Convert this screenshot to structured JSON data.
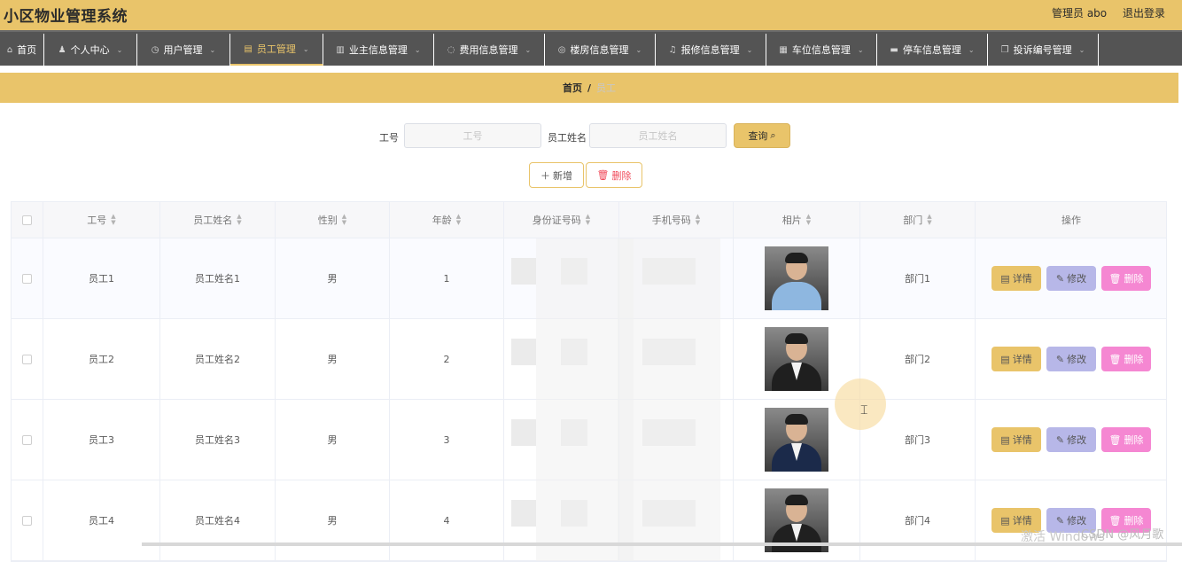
{
  "app": {
    "title": "小区物业管理系统"
  },
  "header": {
    "user_label": "管理员 abo",
    "logout_label": "退出登录"
  },
  "nav": {
    "items": [
      {
        "label": "首页",
        "icon": "home-icon",
        "glyph": "⌂",
        "has_caret": false
      },
      {
        "label": "个人中心",
        "icon": "user-icon",
        "glyph": "♟",
        "has_caret": true
      },
      {
        "label": "用户管理",
        "icon": "clock-icon",
        "glyph": "◷",
        "has_caret": true
      },
      {
        "label": "员工管理",
        "icon": "document-icon",
        "glyph": "▤",
        "has_caret": true,
        "active": true
      },
      {
        "label": "业主信息管理",
        "icon": "bar-chart-icon",
        "glyph": "▥",
        "has_caret": true
      },
      {
        "label": "费用信息管理",
        "icon": "info-circle-icon",
        "glyph": "◌",
        "has_caret": true
      },
      {
        "label": "楼房信息管理",
        "icon": "compass-icon",
        "glyph": "◎",
        "has_caret": true
      },
      {
        "label": "报修信息管理",
        "icon": "bell-icon",
        "glyph": "♫",
        "has_caret": true
      },
      {
        "label": "车位信息管理",
        "icon": "grid-icon",
        "glyph": "▦",
        "has_caret": true
      },
      {
        "label": "停车信息管理",
        "icon": "monitor-icon",
        "glyph": "▬",
        "has_caret": true
      },
      {
        "label": "投诉编号管理",
        "icon": "copy-icon",
        "glyph": "❐",
        "has_caret": true
      }
    ]
  },
  "breadcrumb": {
    "home": "首页",
    "separator": "/",
    "current": "员工"
  },
  "search": {
    "id_label": "工号",
    "id_placeholder": "工号",
    "name_label": "员工姓名",
    "name_placeholder": "员工姓名",
    "query_label": "查询"
  },
  "actions": {
    "add_label": "新增",
    "delete_label": "删除"
  },
  "table": {
    "columns": [
      "工号",
      "员工姓名",
      "性别",
      "年龄",
      "身份证号码",
      "手机号码",
      "相片",
      "部门",
      "操作"
    ],
    "rows": [
      {
        "id": "员工1",
        "name": "员工姓名1",
        "gender": "男",
        "age": "1",
        "dept": "部门1",
        "suit_color": "#8eb7e0",
        "collar": "#8eb7e0"
      },
      {
        "id": "员工2",
        "name": "员工姓名2",
        "gender": "男",
        "age": "2",
        "dept": "部门2",
        "suit_color": "#1f1f1f",
        "collar": "#f2f2f2"
      },
      {
        "id": "员工3",
        "name": "员工姓名3",
        "gender": "男",
        "age": "3",
        "dept": "部门3",
        "suit_color": "#1b2a4a",
        "collar": "#f2f2f2"
      },
      {
        "id": "员工4",
        "name": "员工姓名4",
        "gender": "男",
        "age": "4",
        "dept": "部门4",
        "suit_color": "#202020",
        "collar": "#f2f2f2"
      }
    ],
    "op_detail": "详情",
    "op_edit": "修改",
    "op_remove": "删除"
  },
  "watermark": {
    "windows": "激活 Windows",
    "csdn": "CSDN @风月歌"
  },
  "colors": {
    "accent": "#e9c46a",
    "nav_bg": "#545454",
    "edit_btn": "#b7b7e8",
    "remove_btn": "#f587d2"
  }
}
